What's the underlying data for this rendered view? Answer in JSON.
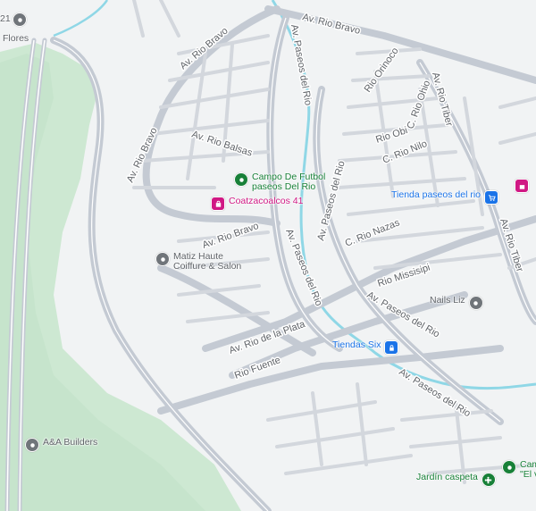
{
  "colors": {
    "background": "#f1f3f4",
    "park": "#cde8d2",
    "park_dark": "#b9dfc2",
    "road": "#c4cad3",
    "road_casing": "#ffffff",
    "river": "#8fd7e6",
    "label": "#5f6368",
    "poi_green": "#188038",
    "poi_pink": "#d01884",
    "poi_blue": "#1a73e8",
    "poi_gray": "#70757a"
  },
  "streets": {
    "rio_bravo_top": "Av. Rio Bravo",
    "rio_bravo_left": "Av. Rio Bravo",
    "rio_bravo_diag": "Av. Rio Bravo",
    "rio_bravo_mid": "Av. Rio Bravo",
    "paseos_rio_top": "Av. Paseos del Rio",
    "paseos_rio_mid": "Av. Paseos del Rio",
    "paseos_rio_right": "Av. Paseos del Rio",
    "paseos_rio_lower": "Av. Paseos del Rio",
    "paseos_rio_bottom": "Av. Paseos del Rio",
    "rio_balsas": "Av. Rio Balsas",
    "rio_orinoco": "Rio Orinoco",
    "rio_ohio": "C. Rio Ohio",
    "rio_obi": "Rio Obi",
    "rio_nilo": "C. Rio Nilo",
    "rio_tiber_top": "Av. Rio Tiber",
    "rio_tiber_bottom": "Av. Rio Tiber",
    "rio_nazas": "C. Rio Nazas",
    "rio_missisipi": "Rio Missisipi",
    "rio_de_la_plata": "Av. Rio de la Plata",
    "rio_fuente": "Rio Fuente"
  },
  "places": {
    "corner_number": "21",
    "flores": "Flores",
    "campo_futbol": "Campo De Futbol paseos Del Rio",
    "coatzacoalcos": "Coatzacoalcos 41",
    "matiz": "Matiz Haute Coiffure & Salon",
    "tienda_paseos": "Tienda paseos del rio",
    "nails_liz": "Nails Liz",
    "tiendas_six": "Tiendas Six",
    "aa_builders": "A&A Builders",
    "jardin_caspeta": "Jardín caspeta",
    "campo_corner": "Cam \"El v"
  },
  "icons": {
    "generic_pin": "place-pin-icon",
    "park_pin": "park-icon",
    "shopping_bag": "shopping-bag-icon",
    "shopping_cart": "shopping-cart-icon",
    "lock_store": "store-lock-icon",
    "flower": "flower-icon"
  }
}
